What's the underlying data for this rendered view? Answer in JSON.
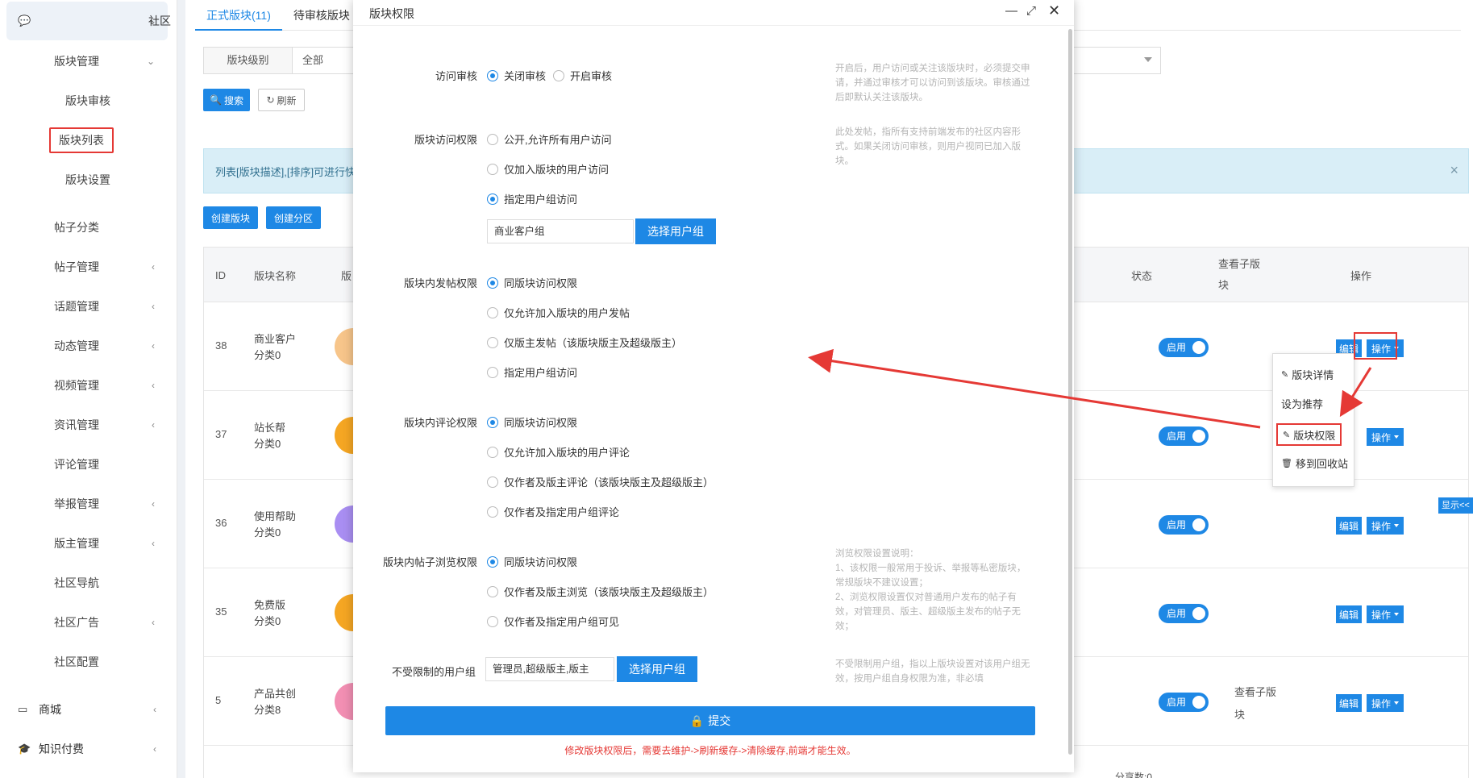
{
  "sidebar": {
    "top": {
      "label": "社区"
    },
    "items": [
      {
        "label": "版块管理",
        "chev": "⌄"
      },
      {
        "label": "版块审核"
      },
      {
        "label": "版块列表"
      },
      {
        "label": "版块设置"
      },
      {
        "label": "帖子分类"
      },
      {
        "label": "帖子管理",
        "chev": "‹"
      },
      {
        "label": "话题管理",
        "chev": "‹"
      },
      {
        "label": "动态管理",
        "chev": "‹"
      },
      {
        "label": "视频管理",
        "chev": "‹"
      },
      {
        "label": "资讯管理",
        "chev": "‹"
      },
      {
        "label": "评论管理"
      },
      {
        "label": "举报管理",
        "chev": "‹"
      },
      {
        "label": "版主管理",
        "chev": "‹"
      },
      {
        "label": "社区导航"
      },
      {
        "label": "社区广告",
        "chev": "‹"
      },
      {
        "label": "社区配置"
      }
    ],
    "bottom": [
      {
        "label": "商城",
        "chev": "‹"
      },
      {
        "label": "知识付费",
        "chev": "‹"
      }
    ]
  },
  "tabs": [
    {
      "label": "正式版块(11)"
    },
    {
      "label": "待审核版块"
    }
  ],
  "filter": {
    "label": "版块级别",
    "value": "全部"
  },
  "buttons": {
    "search": "搜索",
    "refresh": "刷新",
    "create": "创建版块",
    "create_zone": "创建分区"
  },
  "info_text": "列表[版块描述],[排序]可进行快",
  "table": {
    "headers": {
      "id": "ID",
      "name": "版块名称",
      "cut": "版",
      "status": "状态",
      "sub": "查看子版块",
      "ops": "操作"
    },
    "rows": [
      {
        "id": "38",
        "name": "商业客户",
        "cat": "分类0",
        "status": "启用",
        "sub": ""
      },
      {
        "id": "37",
        "name": "站长帮",
        "cat": "分类0",
        "status": "启用",
        "sub": ""
      },
      {
        "id": "36",
        "name": "使用帮助",
        "cat": "分类0",
        "status": "启用",
        "sub": ""
      },
      {
        "id": "35",
        "name": "免费版",
        "cat": "分类0",
        "status": "启用",
        "sub": ""
      },
      {
        "id": "5",
        "name": "产品共创",
        "cat": "分类8",
        "status": "启用",
        "sub": "查看子版块"
      }
    ],
    "edit": "编辑",
    "op": "操作",
    "footer_text": "分享数:0"
  },
  "dropdown": {
    "items": [
      "版块详情",
      "设为推荐",
      "版块权限",
      "移到回收站"
    ]
  },
  "show_tab": "显示<<",
  "modal": {
    "title": "版块权限",
    "sections": {
      "visit_review": {
        "label": "访问审核",
        "options": [
          "关闭审核",
          "开启审核"
        ],
        "selected": 0,
        "help": "开启后，用户访问或关注该版块时，必须提交申请，并通过审核才可以访问到该版块。审核通过后即默认关注该版块。"
      },
      "visit_perm": {
        "label": "版块访问权限",
        "options": [
          "公开,允许所有用户访问",
          "仅加入版块的用户访问",
          "指定用户组访问"
        ],
        "selected": 2,
        "help": "此处发帖，指所有支持前端发布的社区内容形式。如果关闭访问审核，则用户视同已加入版块。",
        "group_value": "商业客户组",
        "group_btn": "选择用户组"
      },
      "post_perm": {
        "label": "版块内发帖权限",
        "options": [
          "同版块访问权限",
          "仅允许加入版块的用户发帖",
          "仅版主发帖（该版块版主及超级版主）",
          "指定用户组访问"
        ],
        "selected": 0
      },
      "comment_perm": {
        "label": "版块内评论权限",
        "options": [
          "同版块访问权限",
          "仅允许加入版块的用户评论",
          "仅作者及版主评论（该版块版主及超级版主）",
          "仅作者及指定用户组评论"
        ],
        "selected": 0
      },
      "browse_perm": {
        "label": "版块内帖子浏览权限",
        "options": [
          "同版块访问权限",
          "仅作者及版主浏览（该版块版主及超级版主）",
          "仅作者及指定用户组可见"
        ],
        "selected": 0,
        "help": "浏览权限设置说明：\n1、该权限一般常用于投诉、举报等私密版块，常规版块不建议设置；\n2、浏览权限设置仅对普通用户发布的帖子有效，对管理员、版主、超级版主发布的帖子无效；"
      },
      "unlimited": {
        "label": "不受限制的用户组",
        "value": "管理员,超级版主,版主",
        "btn": "选择用户组",
        "help": "不受限制用户组，指以上版块设置对该用户组无效，按用户组自身权限为准，非必填"
      }
    },
    "submit": "提交",
    "warning": "修改版块权限后，需要去维护->刷新缓存->清除缓存,前端才能生效。"
  },
  "colors": {
    "primary": "#1e88e5",
    "annotation": "#e53935"
  }
}
